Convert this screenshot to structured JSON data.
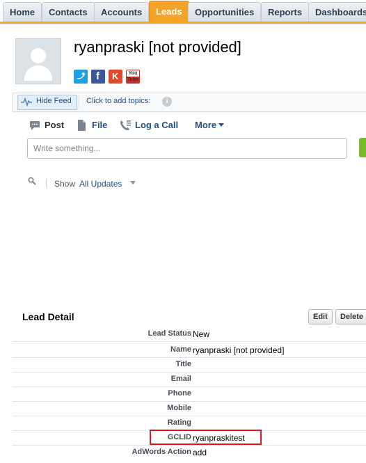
{
  "tabs": [
    {
      "label": "Home"
    },
    {
      "label": "Contacts"
    },
    {
      "label": "Accounts"
    },
    {
      "label": "Leads",
      "active": true
    },
    {
      "label": "Opportunities"
    },
    {
      "label": "Reports"
    },
    {
      "label": "Dashboards"
    }
  ],
  "colors": {
    "accent": "#f5a226",
    "link": "#1f4f86",
    "highlight": "#d7191f"
  },
  "header": {
    "title": "ryanpraski [not provided]",
    "social": [
      {
        "name": "twitter",
        "glyph": "t",
        "color": "#1f9fe0"
      },
      {
        "name": "facebook",
        "glyph": "f",
        "color": "#3b5998"
      },
      {
        "name": "klout",
        "glyph": "K",
        "color": "#e0492b"
      },
      {
        "name": "youtube",
        "glyph": "You Tube",
        "color": "#c4302b"
      }
    ]
  },
  "feed": {
    "hide_feed": "Hide Feed",
    "topics": "Click to add topics:",
    "info_glyph": "i"
  },
  "publisher": {
    "post": "Post",
    "file": "File",
    "log_call": "Log a Call",
    "more": "More",
    "placeholder": "Write something..."
  },
  "filter": {
    "show": "Show",
    "value": "All Updates"
  },
  "lead_detail": {
    "title": "Lead Detail",
    "edit": "Edit",
    "delete": "Delete",
    "fields": [
      {
        "label": "Lead Status",
        "value": "New"
      },
      {
        "label": "Name",
        "value": "ryanpraski [not provided]"
      },
      {
        "label": "Title",
        "value": ""
      },
      {
        "label": "Email",
        "value": ""
      },
      {
        "label": "Phone",
        "value": ""
      },
      {
        "label": "Mobile",
        "value": ""
      },
      {
        "label": "Rating",
        "value": ""
      },
      {
        "label": "GCLID",
        "value": "ryanpraskitest"
      },
      {
        "label": "AdWords Action",
        "value": "add"
      }
    ]
  }
}
